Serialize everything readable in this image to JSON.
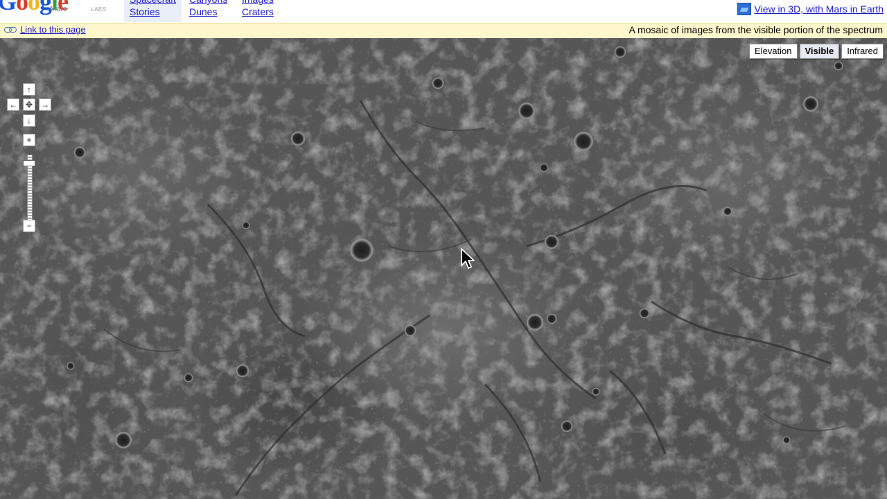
{
  "header": {
    "logo": {
      "wordmark": "Google",
      "sub": "Mars",
      "labs": "LABS"
    },
    "nav_col1": {
      "cut": "Spacecraft",
      "link": "Stories"
    },
    "nav_col2": {
      "cut": "Canyons",
      "link": "Dunes"
    },
    "nav_col3": {
      "cut": "Images",
      "link": "Craters"
    },
    "view3d": "View in 3D, with Mars in Earth"
  },
  "infobar": {
    "link_label": "Link to this page",
    "description": "A mosaic of images from the visible portion of the spectrum"
  },
  "map": {
    "map_types": [
      "Elevation",
      "Visible",
      "Infrared"
    ],
    "selected_map_type": "Visible",
    "controls": {
      "pan_up": "↑",
      "pan_left": "←",
      "pan_center": "✥",
      "pan_right": "→",
      "pan_down": "↓",
      "zoom_in": "+",
      "zoom_out": "−"
    }
  }
}
